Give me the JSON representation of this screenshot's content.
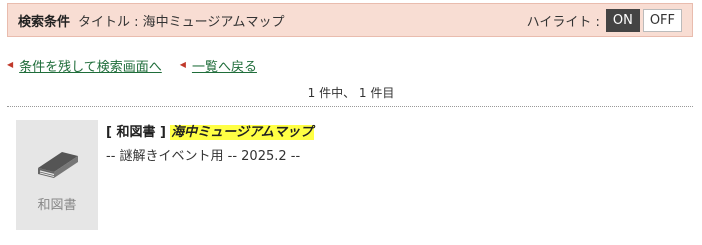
{
  "search_bar": {
    "condition_label": "検索条件",
    "condition_text": "タイトル : 海中ミュージアムマップ",
    "highlight_label": "ハイライト :",
    "on_label": "ON",
    "off_label": "OFF"
  },
  "nav": {
    "back_to_search": "条件を残して検索画面へ",
    "back_to_list": "一覧へ戻る"
  },
  "pagination": {
    "count_text": "1 件中、 1 件目"
  },
  "result": {
    "type_bracket": "[ 和図書 ]",
    "title": "海中ミュージアムマップ",
    "subtitle": "-- 謎解きイベント用 -- 2025.2 --",
    "thumb_label": "和図書",
    "thumb_icon": "book-icon"
  },
  "colors": {
    "search_bg": "#f8ddd3",
    "link": "#1f6d3a",
    "arrow": "#c0392b",
    "highlight": "#ffff44",
    "on_bg": "#444444"
  }
}
